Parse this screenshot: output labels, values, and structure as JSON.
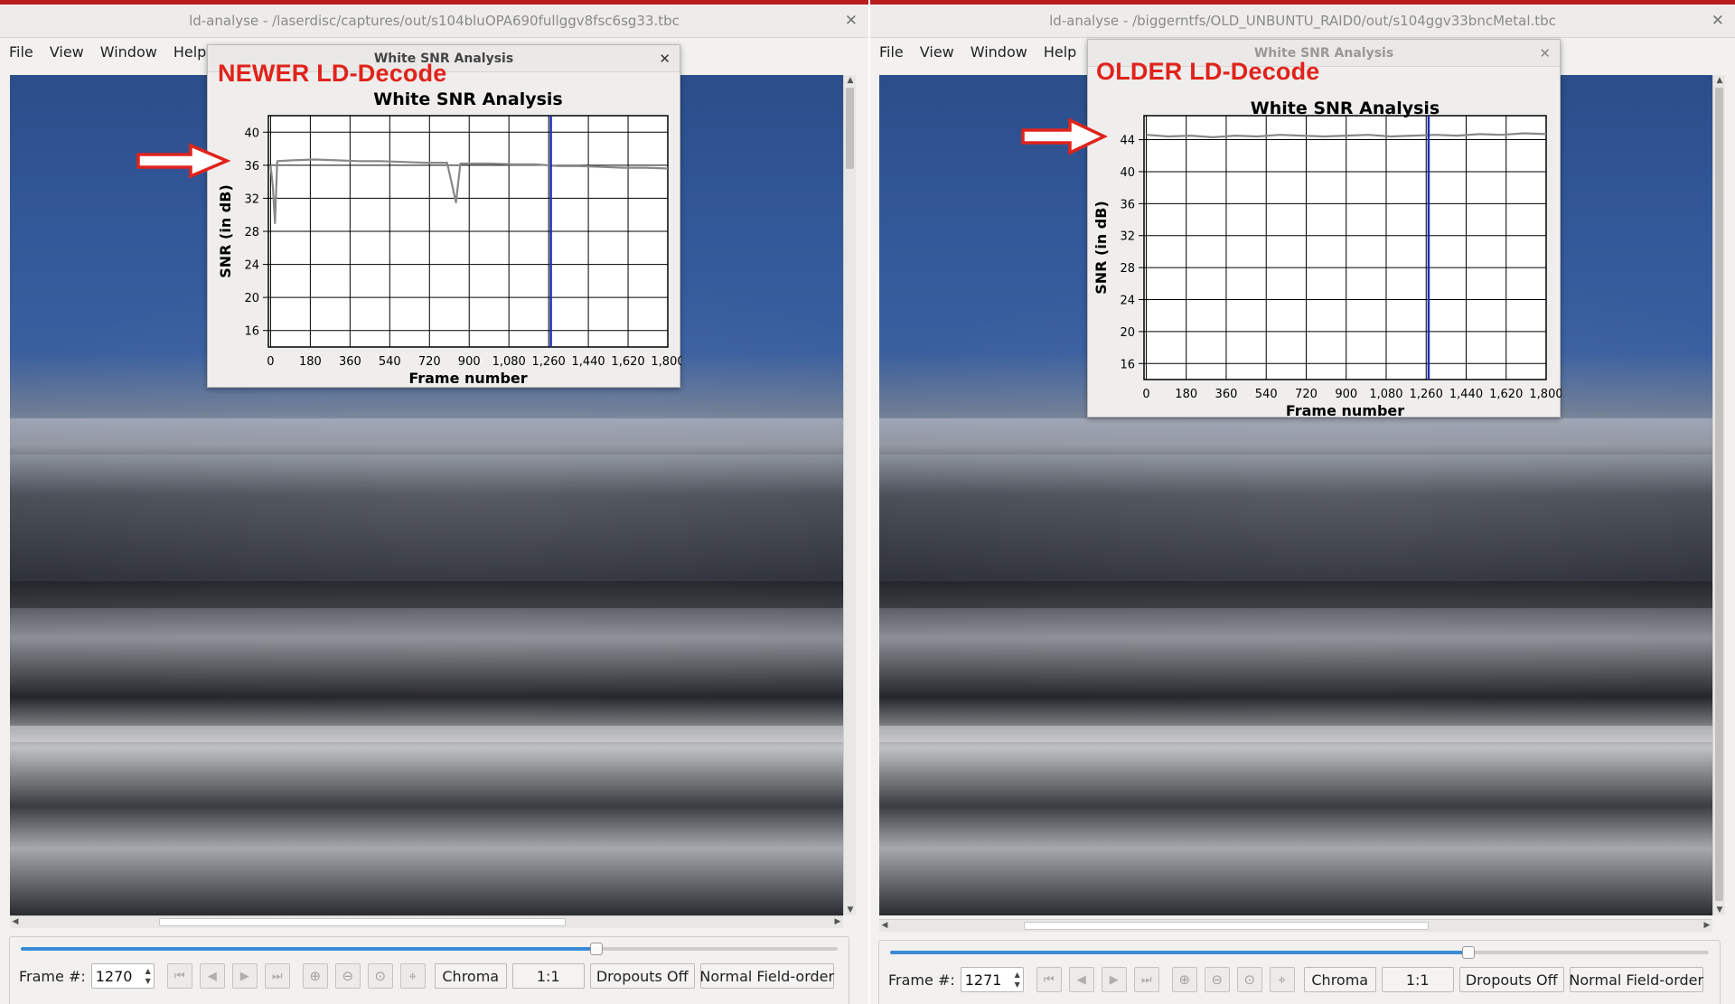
{
  "windows": [
    {
      "title": "ld-analyse - /laserdisc/captures/out/s104bluOPA690fullggv8fsc6sg33.tbc",
      "menu": [
        "File",
        "View",
        "Window",
        "Help"
      ],
      "annotation": "NEWER LD-Decode",
      "dialog": {
        "title": "White SNR Analysis",
        "chart_data": {
          "type": "line",
          "title": "White SNR Analysis",
          "xlabel": "Frame number",
          "ylabel": "SNR (in dB)",
          "xlim": [
            -10,
            1800
          ],
          "ylim": [
            14,
            42
          ],
          "xticks": [
            "0",
            "180",
            "360",
            "540",
            "720",
            "900",
            "1,080",
            "1,260",
            "1,440",
            "1,620",
            "1,800"
          ],
          "yticks": [
            "16",
            "20",
            "24",
            "28",
            "32",
            "36",
            "40"
          ],
          "grid": true,
          "marker_frame": 1270,
          "series": [
            {
              "color": "#888888",
              "x": [
                0,
                10,
                20,
                30,
                100,
                200,
                300,
                400,
                500,
                600,
                700,
                800,
                840,
                860,
                900,
                1000,
                1100,
                1200,
                1260,
                1300,
                1400,
                1500,
                1600,
                1700,
                1800
              ],
              "values": [
                36,
                33.5,
                29,
                36.5,
                36.6,
                36.7,
                36.6,
                36.5,
                36.5,
                36.4,
                36.3,
                36.3,
                31.5,
                36.2,
                36.2,
                36.2,
                36.1,
                36.1,
                36.0,
                35.9,
                35.9,
                35.8,
                35.7,
                35.7,
                35.6
              ]
            }
          ]
        }
      },
      "controls": {
        "frame_label": "Frame #:",
        "frame_value": "1270",
        "chroma": "Chroma",
        "ratio": "1:1",
        "dropouts": "Dropouts Off",
        "field_order": "Normal Field-order",
        "slider_position": 0.705
      }
    },
    {
      "title": "ld-analyse - /biggerntfs/OLD_UNBUNTU_RAID0/out/s104ggv33bncMetal.tbc",
      "menu": [
        "File",
        "View",
        "Window",
        "Help"
      ],
      "annotation": "OLDER LD-Decode",
      "dialog": {
        "title": "White SNR Analysis",
        "chart_data": {
          "type": "line",
          "title": "White SNR Analysis",
          "xlabel": "Frame number",
          "ylabel": "SNR (in dB)",
          "xlim": [
            -10,
            1800
          ],
          "ylim": [
            14,
            47
          ],
          "xticks": [
            "0",
            "180",
            "360",
            "540",
            "720",
            "900",
            "1,080",
            "1,260",
            "1,440",
            "1,620",
            "1,800"
          ],
          "yticks": [
            "16",
            "20",
            "24",
            "28",
            "32",
            "36",
            "40",
            "44"
          ],
          "grid": true,
          "marker_frame": 1271,
          "series": [
            {
              "color": "#888888",
              "x": [
                0,
                100,
                200,
                300,
                400,
                500,
                600,
                700,
                800,
                900,
                1000,
                1100,
                1200,
                1300,
                1400,
                1500,
                1600,
                1700,
                1800
              ],
              "values": [
                44.6,
                44.4,
                44.5,
                44.3,
                44.5,
                44.4,
                44.6,
                44.5,
                44.4,
                44.5,
                44.6,
                44.4,
                44.5,
                44.6,
                44.5,
                44.7,
                44.6,
                44.8,
                44.7
              ]
            }
          ]
        }
      },
      "controls": {
        "frame_label": "Frame #:",
        "frame_value": "1271",
        "chroma": "Chroma",
        "ratio": "1:1",
        "dropouts": "Dropouts Off",
        "field_order": "Normal Field-order",
        "slider_position": 0.706
      }
    }
  ]
}
